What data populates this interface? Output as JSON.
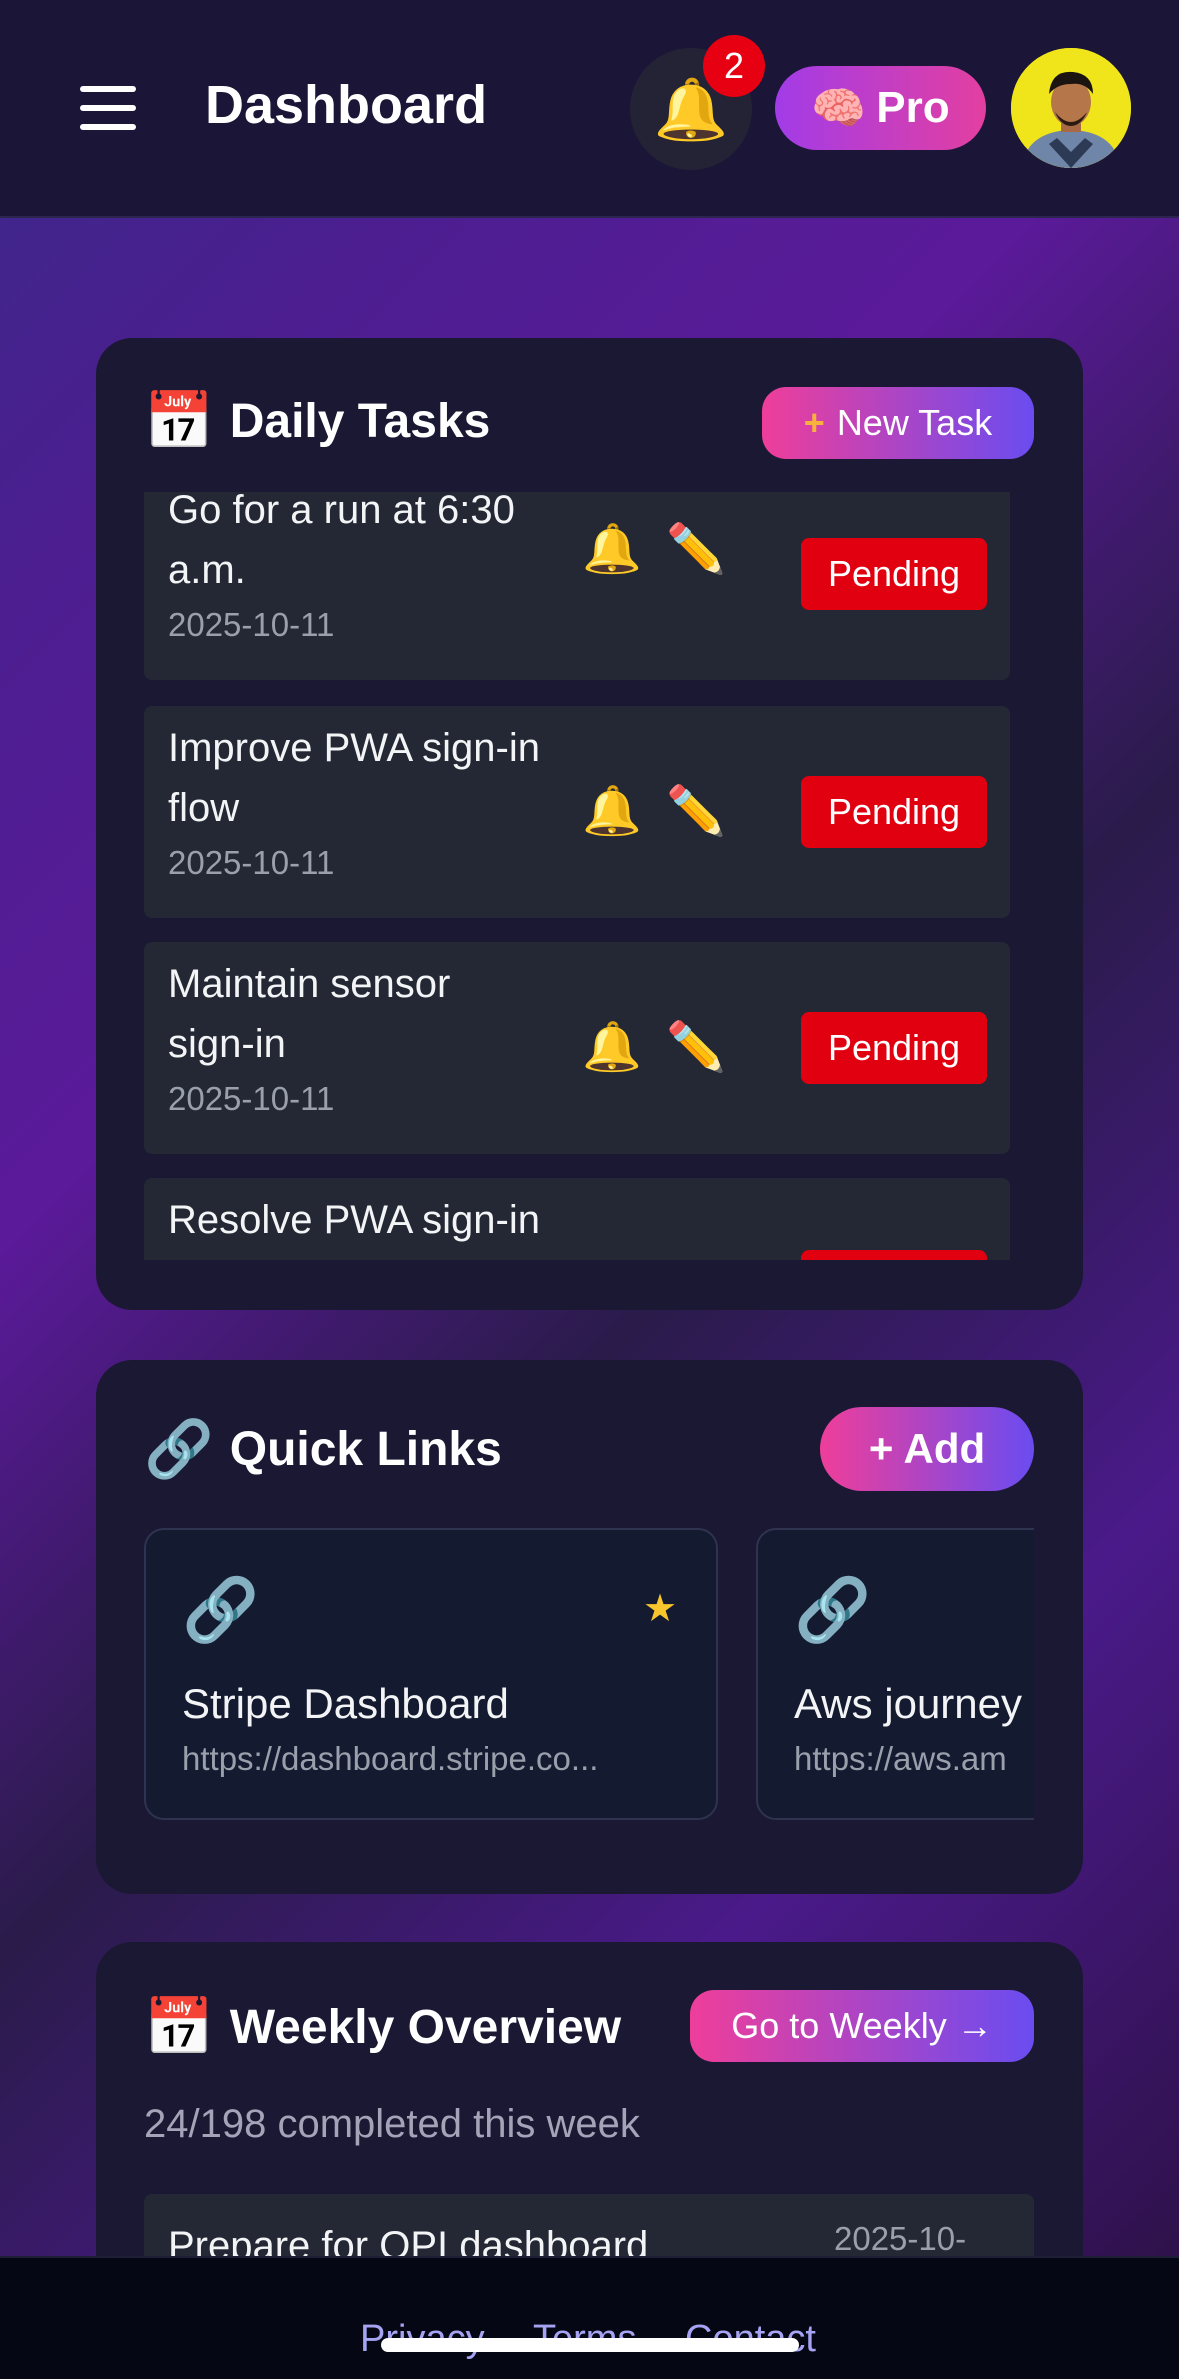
{
  "header": {
    "title": "Dashboard",
    "notification_count": "2",
    "pro_label": "Pro",
    "pro_emoji": "🧠",
    "bell_emoji": "🔔"
  },
  "daily_tasks": {
    "emoji": "📅",
    "title": "Daily Tasks",
    "new_task_plus": "+",
    "new_task_label": "New Task",
    "items": [
      {
        "name": "Go for a run at 6:30 a.m.",
        "date": "2025-10-11",
        "status": "Pending"
      },
      {
        "name": "Improve PWA sign-in flow",
        "date": "2025-10-11",
        "status": "Pending"
      },
      {
        "name": "Maintain sensor sign-in",
        "date": "2025-10-11",
        "status": "Pending"
      },
      {
        "name": "Resolve PWA sign-in",
        "date": "",
        "status": ""
      }
    ],
    "bell_emoji": "🔔",
    "edit_emoji": "✏️"
  },
  "quick_links": {
    "emoji": "🔗",
    "title": "Quick Links",
    "add_label": "+ Add",
    "items": [
      {
        "name": "Stripe Dashboard",
        "url": "https://dashboard.stripe.co...",
        "starred": "★"
      },
      {
        "name": "Aws journey",
        "url": "https://aws.am"
      }
    ],
    "link_emoji": "🔗"
  },
  "weekly": {
    "emoji": "📅",
    "title": "Weekly Overview",
    "go_label": "Go to Weekly →",
    "progress_text": "24/198 completed this week",
    "first_item": {
      "name": "Prepare for QPI dashboard",
      "date": "2025-10-"
    }
  },
  "footer": {
    "privacy": "Privacy",
    "terms": "Terms",
    "contact": "Contact"
  },
  "colors": {
    "accent_pink": "#ef3e9a",
    "accent_violet": "#6a4cf0",
    "pending_red": "#e00010",
    "card_bg": "#1b1833"
  }
}
